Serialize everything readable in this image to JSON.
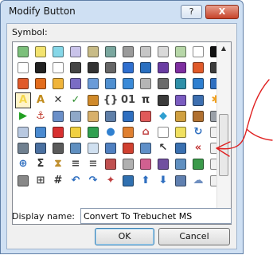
{
  "window": {
    "title": "Modify Button",
    "help_label": "?",
    "close_label": "X"
  },
  "symbol_label": "Symbol:",
  "display_name_label": "Display name:",
  "display_name_value": "Convert To Trebuchet MS",
  "buttons": {
    "ok": "OK",
    "cancel": "Cancel"
  },
  "selected_index": 36,
  "symbols": [
    {
      "name": "green-square-icon",
      "color": "#7cc07b"
    },
    {
      "name": "yellow-square-icon",
      "color": "#f3e36f"
    },
    {
      "name": "cyan-square-icon",
      "color": "#86d7e8"
    },
    {
      "name": "lavender-square-icon",
      "color": "#c9c3ea"
    },
    {
      "name": "khaki-square-icon",
      "color": "#c8bb86"
    },
    {
      "name": "teal-square-icon",
      "color": "#7aa79f"
    },
    {
      "name": "gray-square-icon",
      "color": "#9b9b9b"
    },
    {
      "name": "silver-square-icon",
      "color": "#c6c6c6"
    },
    {
      "name": "light-gray-square-icon",
      "color": "#d9d9d9"
    },
    {
      "name": "pale-green-square-icon",
      "color": "#b7d7a8"
    },
    {
      "name": "white-square-icon",
      "color": "#ffffff"
    },
    {
      "name": "black-square-icon",
      "color": "#111111"
    },
    {
      "name": "bordered-square-icon",
      "color": "#ffffff"
    },
    {
      "name": "bold-border-icon",
      "color": "#222222"
    },
    {
      "name": "dotted-square-icon",
      "color": "#ffffff"
    },
    {
      "name": "half-fill-icon",
      "color": "#444444"
    },
    {
      "name": "bottom-fill-icon",
      "color": "#333333"
    },
    {
      "name": "checker-icon",
      "color": "#666666"
    },
    {
      "name": "arrow-right-circle-icon",
      "color": "#2f6fcf"
    },
    {
      "name": "film-strip-icon",
      "color": "#2a6fc0"
    },
    {
      "name": "drop-icon",
      "color": "#6a3da3"
    },
    {
      "name": "drop-purple-icon",
      "color": "#7e2fa0"
    },
    {
      "name": "chart-bar-icon",
      "color": "#e05a2a"
    },
    {
      "name": "image-icon",
      "color": "#3b3b3b"
    },
    {
      "name": "pie-chart-icon",
      "color": "#e05a2a"
    },
    {
      "name": "ring-icon",
      "color": "#e36c1c"
    },
    {
      "name": "books-icon",
      "color": "#f0b43a"
    },
    {
      "name": "cube-icon",
      "color": "#7a6cc4"
    },
    {
      "name": "document-icon",
      "color": "#6a9bd8"
    },
    {
      "name": "table-icon",
      "color": "#4f8fd0"
    },
    {
      "name": "gradient-icon",
      "color": "#3a8ad8"
    },
    {
      "name": "photo-icon",
      "color": "#b5b5b5"
    },
    {
      "name": "contact-icon",
      "color": "#6b6b6b"
    },
    {
      "name": "bottle-icon",
      "color": "#2e8fa8"
    },
    {
      "name": "sitemap-icon",
      "color": "#2e7fd0"
    },
    {
      "name": "pie-color-icon",
      "color": "#2e6fc0"
    },
    {
      "name": "text-a-icon",
      "color": "#f3d64a",
      "glyph": "A"
    },
    {
      "name": "font-a-icon",
      "color": "#c08a1a",
      "glyph": "A"
    },
    {
      "name": "cross-icon",
      "color": "#333333",
      "glyph": "✕"
    },
    {
      "name": "check-icon",
      "color": "#2f8f2f",
      "glyph": "✓"
    },
    {
      "name": "edit-pencil-icon",
      "color": "#d08a2a"
    },
    {
      "name": "code-icon",
      "color": "#444444",
      "glyph": "{}"
    },
    {
      "name": "number-icon",
      "color": "#444444",
      "glyph": "01"
    },
    {
      "name": "pi-icon",
      "color": "#333333",
      "glyph": "π"
    },
    {
      "name": "binoculars-icon",
      "color": "#3b3b3b"
    },
    {
      "name": "paste-icon",
      "color": "#7a5cc0"
    },
    {
      "name": "brush-icon",
      "color": "#3d6fb0"
    },
    {
      "name": "star-icon",
      "color": "#f0a020",
      "glyph": "✱"
    },
    {
      "name": "play-icon",
      "color": "#22a022",
      "glyph": "▶"
    },
    {
      "name": "anchor-icon",
      "color": "#c0392b",
      "glyph": "⚓"
    },
    {
      "name": "form-icon",
      "color": "#6a8fc8"
    },
    {
      "name": "window-icon",
      "color": "#8fa8c8"
    },
    {
      "name": "package-icon",
      "color": "#d8b06a"
    },
    {
      "name": "calculator-icon",
      "color": "#5f7fa8"
    },
    {
      "name": "filter-icon",
      "color": "#2f6fc0"
    },
    {
      "name": "eraser-icon",
      "color": "#e05a5a"
    },
    {
      "name": "diamond-icon",
      "color": "#2f9fd0",
      "glyph": "◆"
    },
    {
      "name": "pencil-ruler-icon",
      "color": "#d0a040"
    },
    {
      "name": "palette-icon",
      "color": "#b07030"
    },
    {
      "name": "columns-icon",
      "color": "#9aa0a8"
    },
    {
      "name": "textbox-icon",
      "color": "#b8c8e0"
    },
    {
      "name": "globe-doc-icon",
      "color": "#4a8ad0"
    },
    {
      "name": "red-square-icon",
      "color": "#d83030"
    },
    {
      "name": "yellow-box-icon",
      "color": "#f0d040"
    },
    {
      "name": "green-box-icon",
      "color": "#30a050"
    },
    {
      "name": "globe-icon",
      "color": "#3080d0",
      "glyph": "●"
    },
    {
      "name": "tag-icon",
      "color": "#e08030"
    },
    {
      "name": "home-icon",
      "color": "#c04040",
      "glyph": "⌂"
    },
    {
      "name": "checkbox-icon",
      "color": "#ffffff"
    },
    {
      "name": "note-icon",
      "color": "#f0e060"
    },
    {
      "name": "refresh-icon",
      "color": "#3070c0",
      "glyph": "↻"
    },
    {
      "name": "blank-slot-icon",
      "color": "#f0f0f0"
    },
    {
      "name": "list-icon",
      "color": "#708090"
    },
    {
      "name": "link-icon",
      "color": "#4a70a0"
    },
    {
      "name": "camera-icon",
      "color": "#5a5a5a"
    },
    {
      "name": "grid-small-icon",
      "color": "#5f8fc0"
    },
    {
      "name": "card-icon",
      "color": "#d0e0f0"
    },
    {
      "name": "map-icon",
      "color": "#5080c0"
    },
    {
      "name": "award-icon",
      "color": "#d04030"
    },
    {
      "name": "layers-icon",
      "color": "#5f8fc8"
    },
    {
      "name": "cursor-icon",
      "color": "#333333",
      "glyph": "↖"
    },
    {
      "name": "transfer-icon",
      "color": "#3a70b0"
    },
    {
      "name": "abc-convert-icon",
      "color": "#c03030",
      "glyph": "«"
    },
    {
      "name": "blank-slot-2-icon",
      "color": "#f0f0f0"
    },
    {
      "name": "zoom-icon",
      "color": "#2f6fc0",
      "glyph": "⊕"
    },
    {
      "name": "sigma-icon",
      "color": "#333333",
      "glyph": "Σ"
    },
    {
      "name": "hourglass-icon",
      "color": "#c09030",
      "glyph": "⧗"
    },
    {
      "name": "align-left-icon",
      "color": "#444444",
      "glyph": "≡"
    },
    {
      "name": "strike-icon",
      "color": "#555555",
      "glyph": "≡"
    },
    {
      "name": "erase-icon",
      "color": "#c05050"
    },
    {
      "name": "grid-icon",
      "color": "#b0b0b0"
    },
    {
      "name": "dots-color-icon",
      "color": "#d06090"
    },
    {
      "name": "shape-icon",
      "color": "#7050a0"
    },
    {
      "name": "table-grid-icon",
      "color": "#5f8fc0"
    },
    {
      "name": "sheet-icon",
      "color": "#3a9a4a"
    },
    {
      "name": "blank-slot-3-icon",
      "color": "#f0f0f0"
    },
    {
      "name": "dot-grid-icon",
      "color": "#888888"
    },
    {
      "name": "border-grid-icon",
      "color": "#444444",
      "glyph": "⊞"
    },
    {
      "name": "hash-icon",
      "color": "#333333",
      "glyph": "#"
    },
    {
      "name": "undo-icon",
      "color": "#2f6fc0",
      "glyph": "↶"
    },
    {
      "name": "redo-icon",
      "color": "#2f6fc0",
      "glyph": "↷"
    },
    {
      "name": "star-badge-icon",
      "color": "#c04040",
      "glyph": "✦"
    },
    {
      "name": "bullets-icon",
      "color": "#3070b0"
    },
    {
      "name": "arrow-up-icon",
      "color": "#2f6fc0",
      "glyph": "⬆"
    },
    {
      "name": "arrow-down-icon",
      "color": "#2f6fc0",
      "glyph": "⬇"
    },
    {
      "name": "ribbon-icon",
      "color": "#6080b0"
    },
    {
      "name": "cloud-icon",
      "color": "#6f8fc0",
      "glyph": "☁"
    },
    {
      "name": "blank-slot-4-icon",
      "color": "#f0f0f0"
    }
  ],
  "annotation": {
    "color": "#e02020"
  }
}
